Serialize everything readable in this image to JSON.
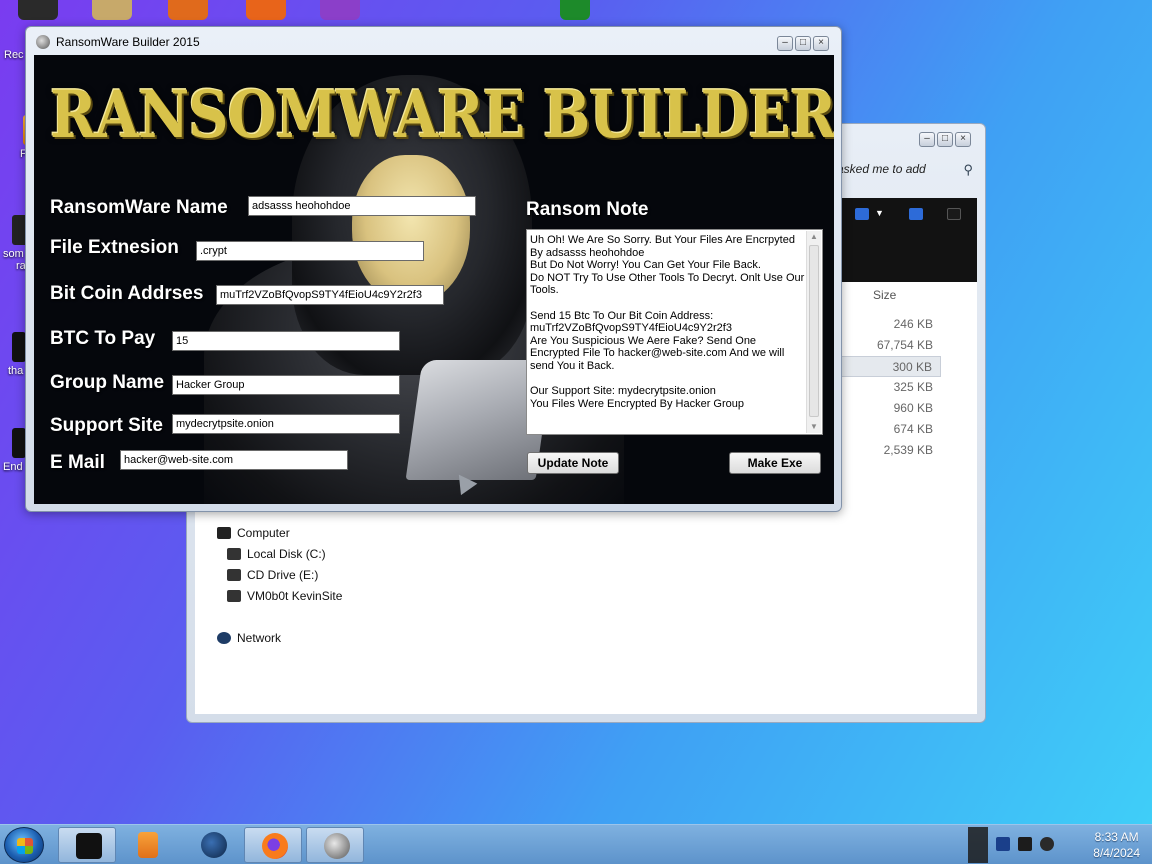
{
  "desktop": {
    "icons": [
      {
        "label": "Rec",
        "icon": "recycle-bin-icon"
      },
      {
        "label": "F",
        "icon": "folder-icon"
      },
      {
        "label": "som",
        "icon": "file-icon"
      },
      {
        "label": "ra",
        "icon": "file-icon"
      },
      {
        "label": "tha",
        "icon": "file-icon"
      },
      {
        "label": "End",
        "icon": "file-icon"
      }
    ]
  },
  "explorer": {
    "search_placeholder": "asked me to add",
    "size_header": "Size",
    "sizes": [
      "246 KB",
      "67,754 KB",
      "300 KB",
      "325 KB",
      "960 KB",
      "674 KB",
      "2,539 KB"
    ],
    "tree": {
      "computer": "Computer",
      "drives": [
        "Local Disk (C:)",
        "CD Drive (E:)",
        "VM0b0t KevinSite"
      ],
      "network": "Network"
    }
  },
  "builder": {
    "window_title": "RansomWare Builder 2015",
    "logo_text": "RANSOMWARE BUILDER 2015",
    "fields": {
      "name_label": "RansomWare Name",
      "name_value": "adsasss heohohdoe",
      "ext_label": "File Extnesion",
      "ext_value": ".crypt",
      "btc_addr_label": "Bit Coin Addrses",
      "btc_addr_value": "muTrf2VZoBfQvopS9TY4fEioU4c9Y2r2f3",
      "btc_pay_label": "BTC To Pay",
      "btc_pay_value": "15",
      "group_label": "Group Name",
      "group_value": "Hacker Group",
      "site_label": "Support Site",
      "site_value": "mydecrytpsite.onion",
      "email_label": "E Mail",
      "email_value": "hacker@web-site.com"
    },
    "note_label": "Ransom Note",
    "note_text": "Uh Oh! We Are So Sorry. But Your Files Are Encrpyted By adsasss heohohdoe\nBut Do Not Worry! You Can Get Your File Back.\nDo NOT Try To Use Other Tools To Decryt. Onlt Use Our Tools.\n\nSend 15 Btc To Our Bit Coin Address:\nmuTrf2VZoBfQvopS9TY4fEioU4c9Y2r2f3\nAre You Suspicious We Aere Fake? Send One Encrypted File To hacker@web-site.com And we will send You it Back.\n\nOur Support Site: mydecrytpsite.onion\nYou Files Were Encrypted By Hacker Group",
    "update_button": "Update Note",
    "make_button": "Make Exe"
  },
  "taskbar": {
    "apps": [
      "terminal",
      "media-player",
      "network-globe",
      "firefox",
      "ransomware-builder"
    ],
    "time": "8:33 AM",
    "date": "8/4/2024"
  },
  "colors": {
    "logo_gold": "#d8c24a",
    "client_bg": "#05070c",
    "taskbar": "#6a9fd4"
  }
}
